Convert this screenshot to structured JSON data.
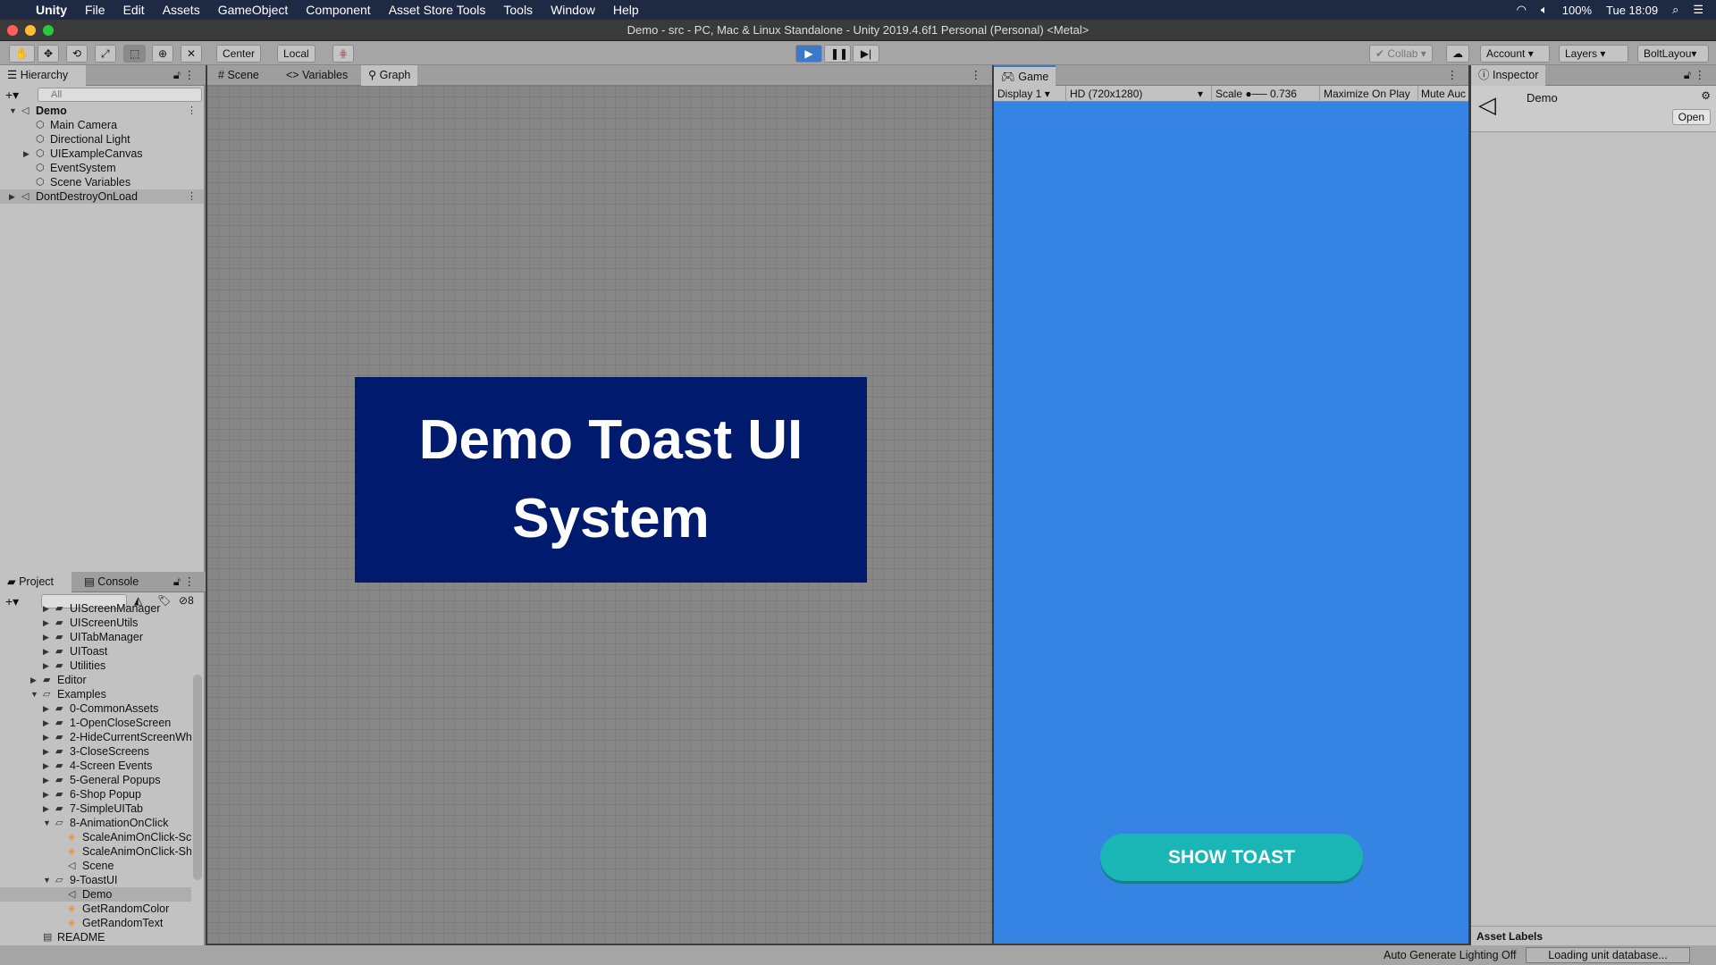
{
  "menubar": {
    "app": "Unity",
    "items": [
      "File",
      "Edit",
      "Assets",
      "GameObject",
      "Component",
      "Asset Store Tools",
      "Tools",
      "Window",
      "Help"
    ],
    "battery": "100%",
    "clock": "Tue 18:09"
  },
  "window": {
    "title": "Demo - src - PC, Mac & Linux Standalone - Unity 2019.4.6f1 Personal (Personal) <Metal>"
  },
  "toolbar": {
    "center": "Center",
    "local": "Local",
    "collab": "Collab",
    "account": "Account",
    "layers": "Layers",
    "layout": "BoltLayou"
  },
  "hierarchy": {
    "tab": "Hierarchy",
    "search_placeholder": "All",
    "items": [
      {
        "label": "Demo",
        "depth": 0,
        "expanded": true,
        "bold": true,
        "icon": "scene-icon"
      },
      {
        "label": "Main Camera",
        "depth": 1,
        "icon": "gameobject-icon"
      },
      {
        "label": "Directional Light",
        "depth": 1,
        "icon": "gameobject-icon"
      },
      {
        "label": "UIExampleCanvas",
        "depth": 1,
        "collapsed": true,
        "icon": "gameobject-icon"
      },
      {
        "label": "EventSystem",
        "depth": 1,
        "icon": "gameobject-icon"
      },
      {
        "label": "Scene Variables",
        "depth": 1,
        "icon": "gameobject-icon"
      },
      {
        "label": "DontDestroyOnLoad",
        "depth": 0,
        "collapsed": true,
        "icon": "scene-icon",
        "selected": true
      }
    ]
  },
  "scene_tabs": [
    "Scene",
    "Variables",
    "Graph"
  ],
  "scene": {
    "banner": "Demo Toast UI System"
  },
  "game": {
    "tab": "Game",
    "display": "Display 1",
    "resolution": "HD (720x1280)",
    "scale_label": "Scale",
    "scale_value": "0.736",
    "maximize": "Maximize On Play",
    "mute": "Mute Auc",
    "button": "SHOW TOAST",
    "bg_color": "#3584e4",
    "button_color": "#1ab6b5"
  },
  "inspector": {
    "tab": "Inspector",
    "object": "Demo",
    "open": "Open",
    "asset_labels": "Asset Labels"
  },
  "project": {
    "tabs": [
      "Project",
      "Console"
    ],
    "hidden_count": "8",
    "items": [
      {
        "label": "UIScreenManager",
        "depth": 2,
        "type": "folder"
      },
      {
        "label": "UIScreenUtils",
        "depth": 2,
        "type": "folder"
      },
      {
        "label": "UITabManager",
        "depth": 2,
        "type": "folder"
      },
      {
        "label": "UIToast",
        "depth": 2,
        "type": "folder"
      },
      {
        "label": "Utilities",
        "depth": 2,
        "type": "folder"
      },
      {
        "label": "Editor",
        "depth": 1,
        "type": "folder"
      },
      {
        "label": "Examples",
        "depth": 1,
        "type": "folder-open"
      },
      {
        "label": "0-CommonAssets",
        "depth": 2,
        "type": "folder"
      },
      {
        "label": "1-OpenCloseScreen",
        "depth": 2,
        "type": "folder"
      },
      {
        "label": "2-HideCurrentScreenWh",
        "depth": 2,
        "type": "folder"
      },
      {
        "label": "3-CloseScreens",
        "depth": 2,
        "type": "folder"
      },
      {
        "label": "4-Screen Events",
        "depth": 2,
        "type": "folder"
      },
      {
        "label": "5-General Popups",
        "depth": 2,
        "type": "folder"
      },
      {
        "label": "6-Shop Popup",
        "depth": 2,
        "type": "folder"
      },
      {
        "label": "7-SimpleUITab",
        "depth": 2,
        "type": "folder"
      },
      {
        "label": "8-AnimationOnClick",
        "depth": 2,
        "type": "folder-open"
      },
      {
        "label": "ScaleAnimOnClick-Sc",
        "depth": 3,
        "type": "asset"
      },
      {
        "label": "ScaleAnimOnClick-Sh",
        "depth": 3,
        "type": "asset"
      },
      {
        "label": "Scene",
        "depth": 3,
        "type": "scene"
      },
      {
        "label": "9-ToastUI",
        "depth": 2,
        "type": "folder-open"
      },
      {
        "label": "Demo",
        "depth": 3,
        "type": "scene",
        "selected": true
      },
      {
        "label": "GetRandomColor",
        "depth": 3,
        "type": "asset"
      },
      {
        "label": "GetRandomText",
        "depth": 3,
        "type": "asset"
      },
      {
        "label": "README",
        "depth": 1,
        "type": "doc"
      }
    ]
  },
  "status": {
    "lighting": "Auto Generate Lighting Off",
    "progress": "Loading unit database..."
  }
}
